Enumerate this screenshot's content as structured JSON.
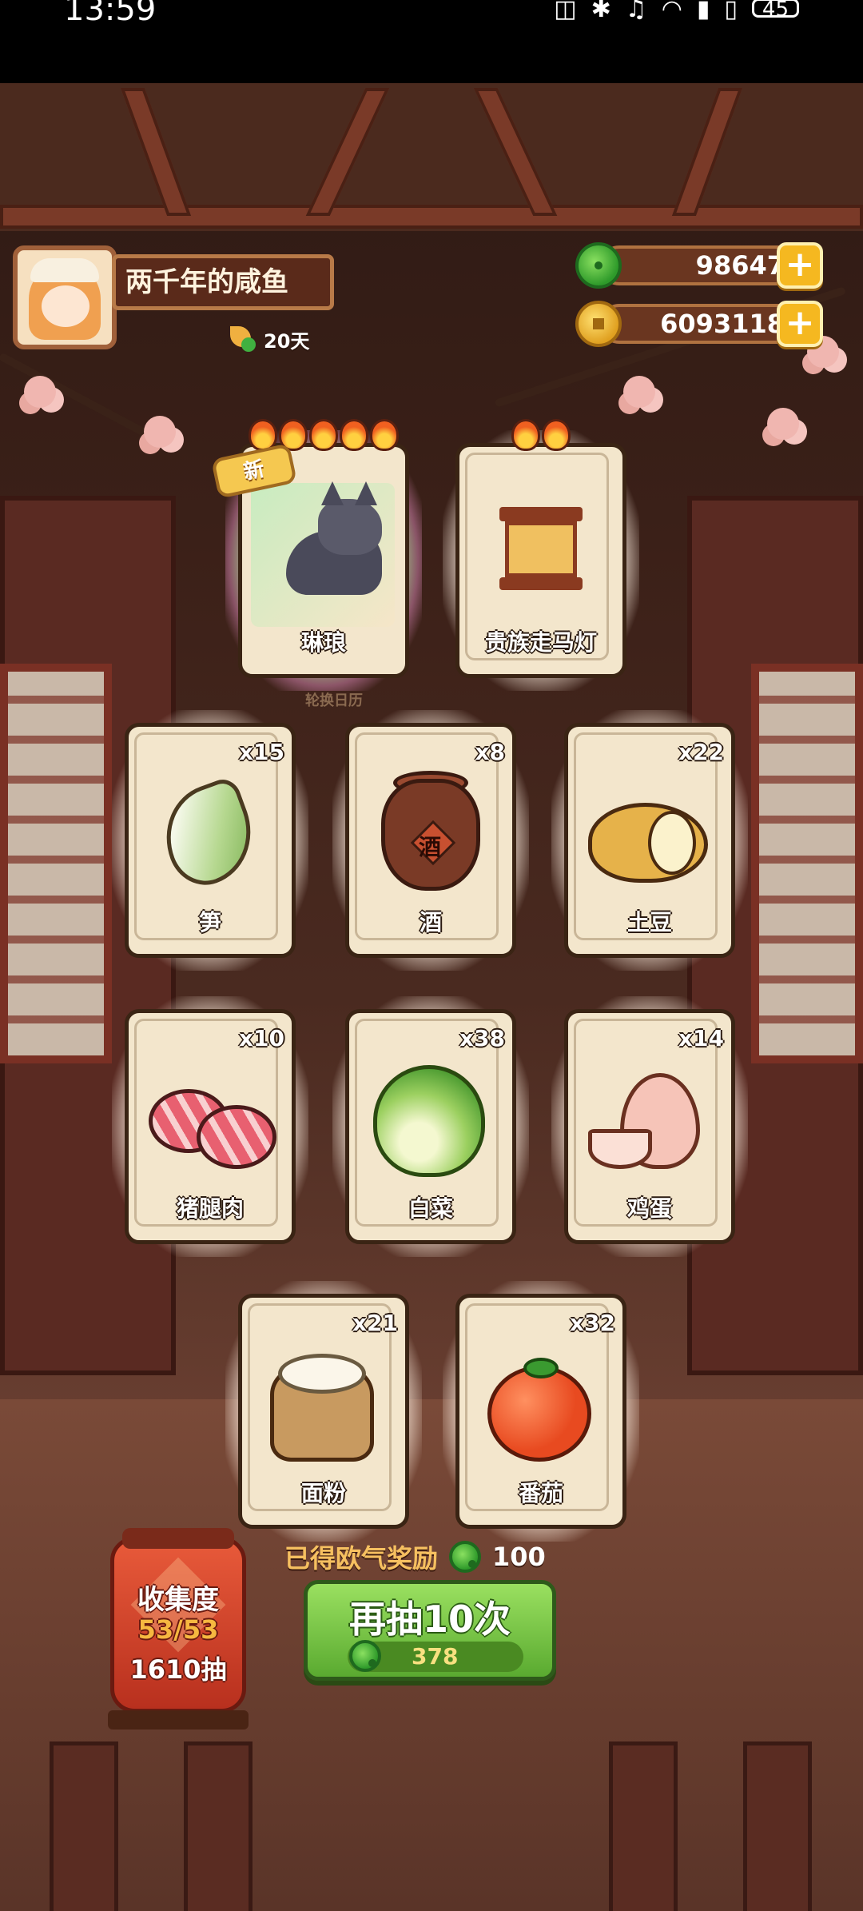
{
  "status_bar": {
    "time": "13:59",
    "icons": [
      "nfc-icon",
      "bluetooth-icon",
      "mute-icon",
      "wifi-icon",
      "signal-icon",
      "signal-icon"
    ],
    "battery": "45"
  },
  "player": {
    "name": "两千年的咸鱼",
    "days": "20天"
  },
  "currencies": {
    "jade": "98647",
    "gold": "6093118"
  },
  "featured_cards": [
    {
      "name": "琳琅",
      "badge": "新",
      "stars": 5
    },
    {
      "name": "贵族走马灯",
      "stars": 2
    }
  ],
  "calendar_label": "轮换日历",
  "items": [
    {
      "name": "笋",
      "count": "x15"
    },
    {
      "name": "酒",
      "count": "x8"
    },
    {
      "name": "土豆",
      "count": "x22"
    },
    {
      "name": "猪腿肉",
      "count": "x10"
    },
    {
      "name": "白菜",
      "count": "x38"
    },
    {
      "name": "鸡蛋",
      "count": "x14"
    },
    {
      "name": "面粉",
      "count": "x21"
    },
    {
      "name": "番茄",
      "count": "x32"
    }
  ],
  "jar_text": "酒",
  "reward": {
    "text": "已得欧气奖励",
    "value": "100"
  },
  "draw_button": {
    "label": "再抽10次",
    "cost": "378"
  },
  "collection": {
    "title": "收集度",
    "progress": "53/53",
    "draws": "1610抽"
  },
  "colors": {
    "accent_green": "#5aaa30",
    "gold": "#f5b820",
    "card_bg": "#f3e6cc"
  }
}
